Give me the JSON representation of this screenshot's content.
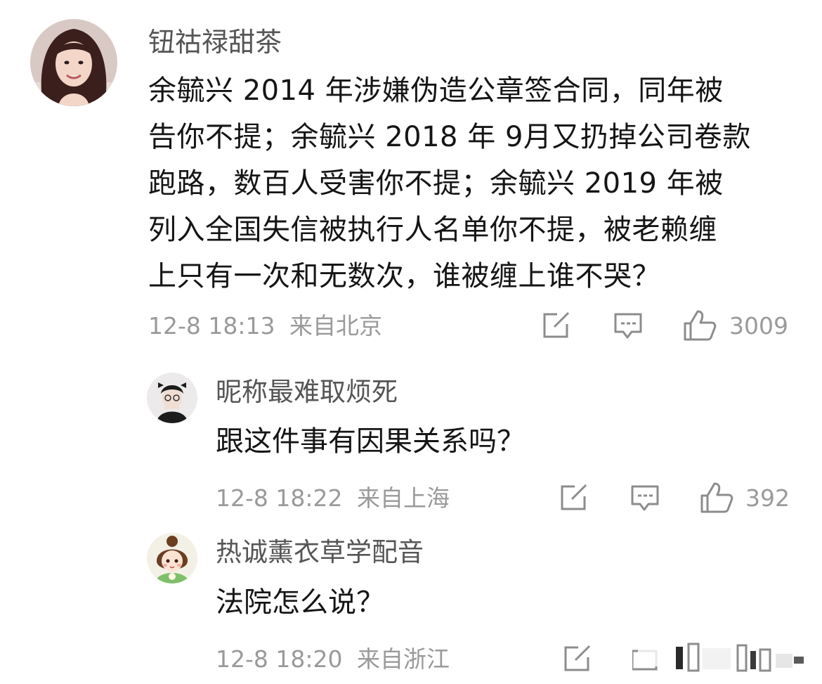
{
  "comments": [
    {
      "username": "钮祜禄甜茶",
      "lines": [
        "余毓兴 2014 年涉嫌伪造公章签合同，同年被",
        "告你不提；余毓兴 2018 年 9月又扔掉公司卷款",
        "跑路，数百人受害你不提；余毓兴 2019 年被",
        "列入全国失信被执行人名单你不提，被老赖缠",
        "上只有一次和无数次，谁被缠上谁不哭？"
      ],
      "time": "12-8 18:13",
      "location": "来自北京",
      "like_count": "3009",
      "icons": [
        "share-icon",
        "comment-icon",
        "like-icon"
      ]
    },
    {
      "username": "昵称最难取烦死",
      "text": "跟这件事有因果关系吗？",
      "time": "12-8 18:22",
      "location": "来自上海",
      "like_count": "392",
      "icons": [
        "share-icon",
        "comment-icon",
        "like-icon"
      ]
    },
    {
      "username": "热诚薰衣草学配音",
      "text": "法院怎么说？",
      "time": "12-8 18:20",
      "location": "来自浙江",
      "icons": [
        "share-icon"
      ]
    }
  ],
  "colors": {
    "text": "#151515",
    "username": "#555555",
    "meta": "#9a9a9a"
  }
}
